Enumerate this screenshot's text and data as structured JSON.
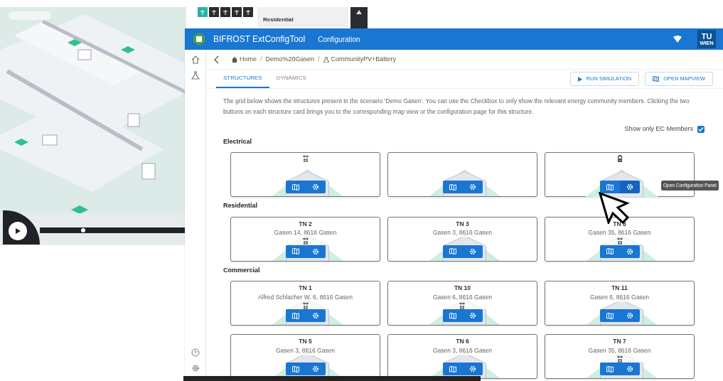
{
  "map": {
    "toolbar": [
      {
        "selected": true
      },
      {
        "selected": false
      },
      {
        "selected": false
      },
      {
        "selected": false
      },
      {
        "selected": false
      }
    ],
    "panel_title": "Residential"
  },
  "app": {
    "title": "BIFROST ExtConfigTool",
    "section": "Configuration",
    "logo": [
      "TU",
      "WIEN"
    ],
    "breadcrumb": [
      "Home",
      "Demo%20Gasen",
      "CommunityPV+Battery"
    ],
    "breadcrumb_separator": "/",
    "tabs": [
      {
        "label": "STRUCTURES",
        "selected": true
      },
      {
        "label": "DYNAMICS",
        "selected": false
      }
    ],
    "actions": [
      "RUN SIMULATION",
      "OPEN MAPVIEW"
    ],
    "description": "The grid below shows the structures present in the scenario 'Demo Gasen'. You can use the Checkbox to only show the relevant energy community members. Clicking the two buttons on each structure card brings you to the corresponding map view or the configuration page for this structure.",
    "filter": {
      "label": "Show only EC Members",
      "checked": true
    },
    "tooltip": "Open Configuration Panel",
    "groups": [
      {
        "title": "Electrical",
        "cards": [
          {
            "kind": "grid"
          },
          {
            "kind": "plain"
          },
          {
            "kind": "battery",
            "hovered": true
          }
        ]
      },
      {
        "title": "Residential",
        "cards": [
          {
            "kind": "grid",
            "title": "TN 2",
            "address": "Gasen 14, 8616 Gasen"
          },
          {
            "kind": "plain",
            "title": "TN 3",
            "address": "Gasen 3, 8616 Gasen"
          },
          {
            "kind": "grid",
            "title": "TN 8",
            "address": "Gasen 35, 8616 Gasen"
          }
        ]
      },
      {
        "title": "Commercial",
        "cards": [
          {
            "kind": "grid",
            "title": "TN 1",
            "address": "Alfred Schlacher W. 6, 8616 Gasen"
          },
          {
            "kind": "grid",
            "title": "TN 10",
            "address": "Gasen 6, 8616 Gasen"
          },
          {
            "kind": "plain",
            "title": "TN 11",
            "address": "Gasen 6, 8616 Gasen"
          },
          {
            "kind": "plain",
            "title": "TN 5",
            "address": "Gasen 3, 8616 Gasen"
          },
          {
            "kind": "plain",
            "title": "TN 6",
            "address": "Gasen 3, 8616 Gasen"
          },
          {
            "kind": "grid",
            "title": "TN 7",
            "address": "Gasen 35, 8616 Gasen"
          }
        ]
      }
    ]
  }
}
